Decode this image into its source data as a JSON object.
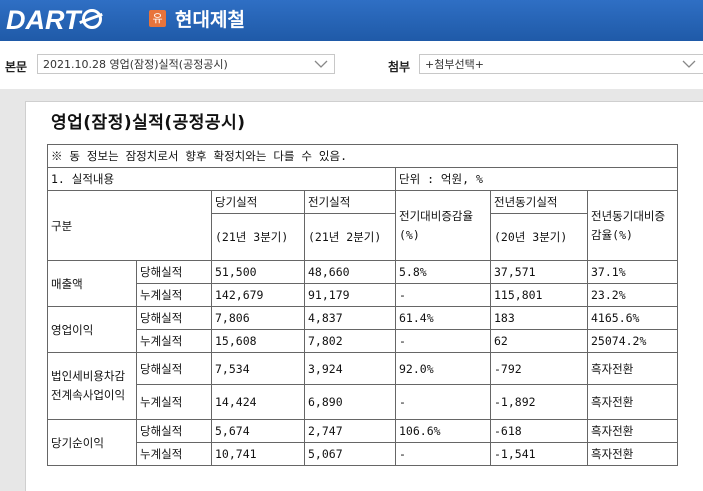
{
  "header": {
    "logo_text": "DART",
    "badge": "유",
    "company": "현대제철"
  },
  "toolbar": {
    "main_label": "본문",
    "main_selected": "2021.10.28  영업(잠정)실적(공정공시)",
    "attach_label": "첨부",
    "attach_selected": "+첨부선택+"
  },
  "document": {
    "title": "영업(잠정)실적(공정공시)",
    "notice": "※ 동 정보는 잠정치로서 향후 확정치와는 다를 수 있음.",
    "section": "1. 실적내용",
    "unit": "단위 : 억원, %",
    "col_header": {
      "group": "구분",
      "current": "당기실적",
      "current_period": "(21년 3분기)",
      "prev": "전기실적",
      "prev_period": "(21년 2분기)",
      "qoq": "전기대비증감율(%)",
      "yoy_actual": "전년동기실적",
      "yoy_period": "(20년 3분기)",
      "yoy": "전년동기대비증감율(%)"
    },
    "rows": [
      {
        "item": "매출액",
        "sub": "당해실적",
        "cur": "51,500",
        "prev": "48,660",
        "qoq": "5.8%",
        "ly": "37,571",
        "yoy": "37.1%"
      },
      {
        "item": "",
        "sub": "누계실적",
        "cur": "142,679",
        "prev": "91,179",
        "qoq": "-",
        "ly": "115,801",
        "yoy": "23.2%"
      },
      {
        "item": "영업이익",
        "sub": "당해실적",
        "cur": "7,806",
        "prev": "4,837",
        "qoq": "61.4%",
        "ly": "183",
        "yoy": "4165.6%"
      },
      {
        "item": "",
        "sub": "누계실적",
        "cur": "15,608",
        "prev": "7,802",
        "qoq": "-",
        "ly": "62",
        "yoy": "25074.2%"
      },
      {
        "item": "법인세비용차감전계속사업이익",
        "sub": "당해실적",
        "cur": "7,534",
        "prev": "3,924",
        "qoq": "92.0%",
        "ly": "-792",
        "yoy": "흑자전환"
      },
      {
        "item": "",
        "sub": "누계실적",
        "cur": "14,424",
        "prev": "6,890",
        "qoq": "-",
        "ly": "-1,892",
        "yoy": "흑자전환"
      },
      {
        "item": "당기순이익",
        "sub": "당해실적",
        "cur": "5,674",
        "prev": "2,747",
        "qoq": "106.6%",
        "ly": "-618",
        "yoy": "흑자전환"
      },
      {
        "item": "",
        "sub": "누계실적",
        "cur": "10,741",
        "prev": "5,067",
        "qoq": "-",
        "ly": "-1,541",
        "yoy": "흑자전환"
      }
    ]
  }
}
